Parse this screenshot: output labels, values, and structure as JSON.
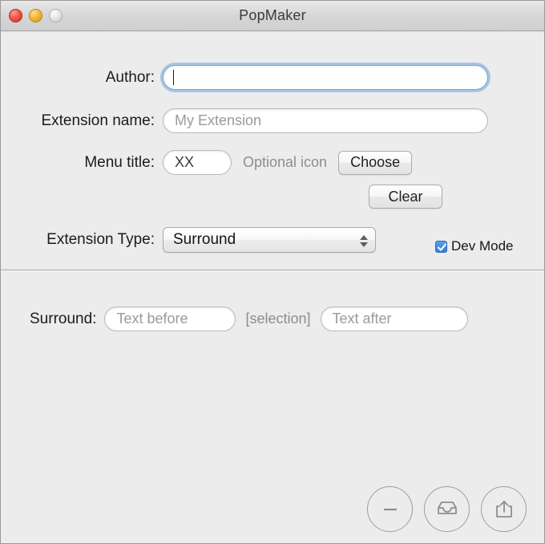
{
  "window": {
    "title": "PopMaker",
    "traffic_lights": [
      {
        "name": "close",
        "color": "#f2574b"
      },
      {
        "name": "minimize",
        "color": "#f4b73d"
      },
      {
        "name": "zoom",
        "color": "#e4e4e4"
      }
    ]
  },
  "form": {
    "author": {
      "label": "Author:",
      "value": "",
      "placeholder": "",
      "focused": true
    },
    "extension_name": {
      "label": "Extension name:",
      "value": "",
      "placeholder": "My Extension"
    },
    "menu_title": {
      "label": "Menu title:",
      "value": "XX",
      "placeholder": "XX"
    },
    "optional_icon": {
      "label": "Optional icon",
      "choose_label": "Choose",
      "clear_label": "Clear"
    },
    "extension_type": {
      "label": "Extension Type:",
      "selected": "Surround"
    },
    "dev_mode": {
      "label": "Dev Mode",
      "checked": true,
      "accent": "#2f7fdc"
    }
  },
  "surround": {
    "label": "Surround:",
    "text_before_placeholder": "Text before",
    "selection_token": "[selection]",
    "text_after_placeholder": "Text after"
  },
  "toolbar": {
    "buttons": [
      {
        "name": "remove-icon",
        "title": "Remove"
      },
      {
        "name": "inbox-icon",
        "title": "Install"
      },
      {
        "name": "share-icon",
        "title": "Export"
      }
    ]
  }
}
